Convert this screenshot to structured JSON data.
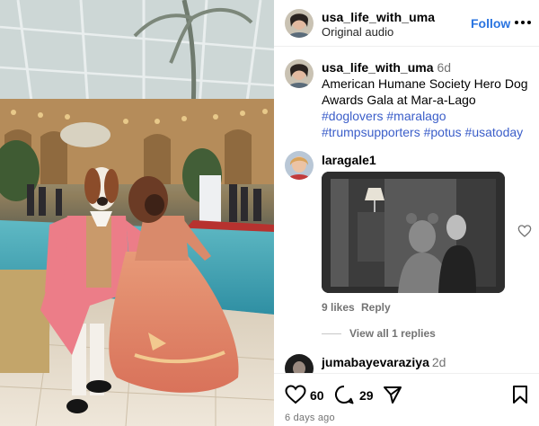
{
  "post": {
    "author": "usa_life_with_uma",
    "audio": "Original audio",
    "follow_label": "Follow",
    "more_icon": "more-horizontal-icon"
  },
  "caption": {
    "author": "usa_life_with_uma",
    "time": "6d",
    "text": "American Humane Society Hero Dog Awards Gala at Mar-a-Lago",
    "hashtags": [
      "#doglovers",
      "#maralago",
      "#trumpsupporters",
      "#potus",
      "#usatoday"
    ]
  },
  "comments": [
    {
      "user": "laragale1",
      "likes": "9 likes",
      "reply_label": "Reply",
      "view_replies": "View all 1 replies"
    },
    {
      "user": "jumabayevaraziya",
      "time": "2d"
    }
  ],
  "actions": {
    "likes": "60",
    "comments": "29",
    "posted": "6 days ago",
    "icons": [
      "heart-icon",
      "comment-icon",
      "share-icon",
      "bookmark-icon"
    ]
  },
  "colors": {
    "link": "#2a74e0",
    "hashtag": "#3b5ec9",
    "muted": "#737373"
  }
}
